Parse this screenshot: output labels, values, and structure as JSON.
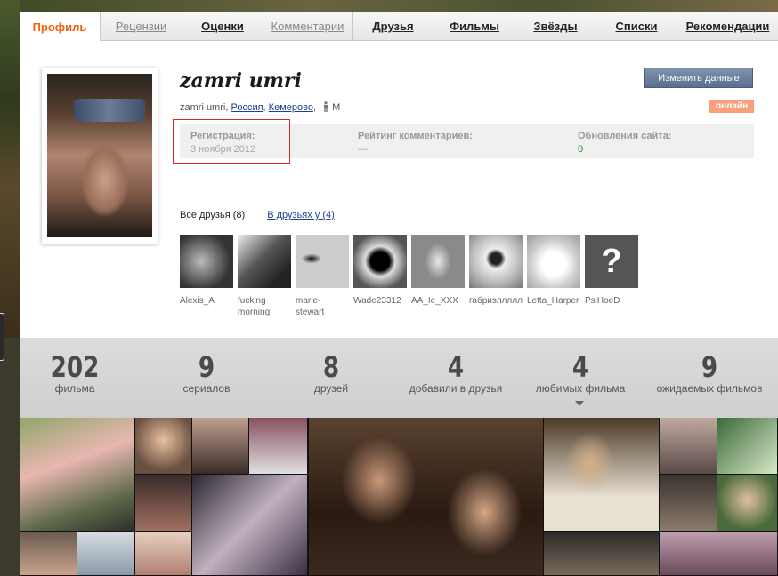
{
  "tabs": [
    {
      "label": "Профиль",
      "state": "active",
      "w": 90
    },
    {
      "label": "Рецензии",
      "state": "muted",
      "w": 92
    },
    {
      "label": "Оценки",
      "state": "normal",
      "w": 91
    },
    {
      "label": "Комментарии",
      "state": "muted",
      "w": 100
    },
    {
      "label": "Друзья",
      "state": "normal",
      "w": 92
    },
    {
      "label": "Фильмы",
      "state": "normal",
      "w": 91
    },
    {
      "label": "Звёзды",
      "state": "normal",
      "w": 91
    },
    {
      "label": "Списки",
      "state": "normal",
      "w": 91
    },
    {
      "label": "Рекомендации",
      "state": "normal",
      "w": 114
    }
  ],
  "profile": {
    "username": "zamri umri",
    "login": "zamri umri",
    "country": "Россия",
    "city": "Кемерово",
    "gender": "М",
    "edit_button": "Изменить данные",
    "online": "онлайн"
  },
  "stats": {
    "registration_label": "Регистрация:",
    "registration_value": "3 ноября 2012",
    "rating_label": "Рейтинг комментариев:",
    "rating_value": "—",
    "updates_label": "Обновления сайта:",
    "updates_value": "0"
  },
  "friends_section": {
    "all_label": "Все друзья (8)",
    "in_friends_label": "В друзьях у (4)"
  },
  "friends": [
    {
      "name": "Alexis_A"
    },
    {
      "name": "fucking morning"
    },
    {
      "name": "marie-stewart"
    },
    {
      "name": "Wade23312"
    },
    {
      "name": "AA_Ie_XXX"
    },
    {
      "name": "габриэлллллл"
    },
    {
      "name": "Letta_Harper"
    },
    {
      "name": "PsiHoeD"
    }
  ],
  "counters": [
    {
      "num": "202",
      "label": "фильма"
    },
    {
      "num": "9",
      "label": "сериалов"
    },
    {
      "num": "8",
      "label": "друзей"
    },
    {
      "num": "4",
      "label": "добавили в друзья"
    },
    {
      "num": "4",
      "label": "любимых фильма"
    },
    {
      "num": "9",
      "label": "ожидаемых фильмов"
    }
  ],
  "colors": {
    "accent": "#f06010",
    "link": "#1f3f8f",
    "online": "#f8a07a",
    "button": "#5a7090",
    "highlight": "#d9262c"
  }
}
